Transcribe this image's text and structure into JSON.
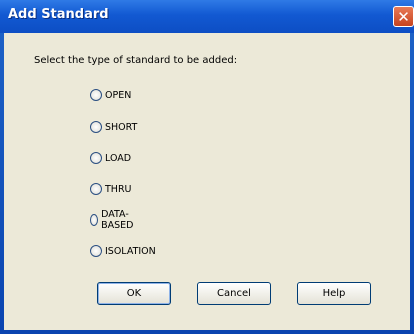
{
  "window": {
    "title": "Add Standard",
    "close_glyph": "✕"
  },
  "prompt": "Select the type of standard to be added:",
  "options": [
    "OPEN",
    "SHORT",
    "LOAD",
    "THRU",
    "DATA-BASED",
    "ISOLATION"
  ],
  "buttons": {
    "ok": "OK",
    "cancel": "Cancel",
    "help": "Help"
  },
  "colors": {
    "title_bar": "#1259d2",
    "dialog_bg": "#ece9d8",
    "close_button": "#c6431f"
  }
}
